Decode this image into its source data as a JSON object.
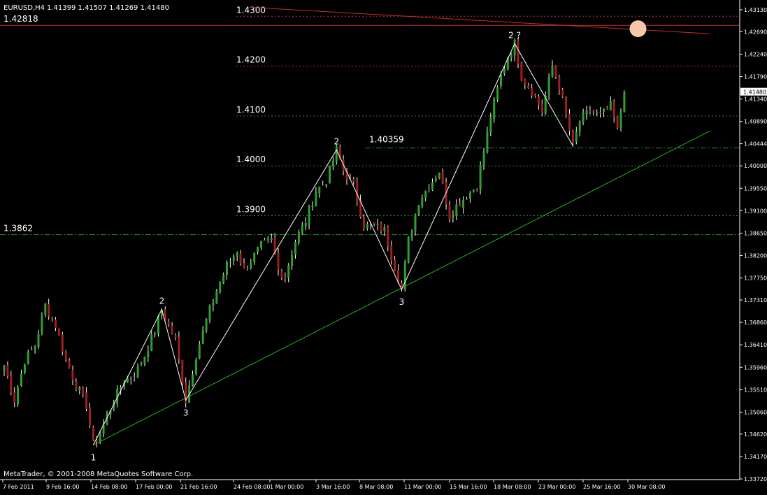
{
  "header": {
    "symbol": "EURUSD,H4",
    "ohlc": "1.41399 1.41507 1.41269 1.41480"
  },
  "footer": {
    "copyright": "MetaTrader, © 2001-2008 MetaQuotes Software Corp."
  },
  "colors": {
    "background": "#000000",
    "axis": "#ffffff",
    "bull": "#2ea02e",
    "bear": "#a0201e",
    "wick": "#ffffff",
    "level_red": "#c0302e",
    "level_green": "#2a8a2a",
    "trendline_red": "#c0302e",
    "trendline_green": "#22b322",
    "wave": "#ffffff",
    "marker": "#f4c8a8"
  },
  "chart_data": {
    "type": "candlestick",
    "symbol": "EURUSD",
    "timeframe": "H4",
    "y_ticks": [
      "1.43130",
      "1.42690",
      "1.42240",
      "1.41790",
      "1.41340",
      "1.40890",
      "1.40444",
      "1.40000",
      "1.39550",
      "1.39100",
      "1.38650",
      "1.38200",
      "1.37750",
      "1.37310",
      "1.36860",
      "1.36410",
      "1.35960",
      "1.35510",
      "1.35060",
      "1.34620",
      "1.34170",
      "1.33720"
    ],
    "x_ticks": [
      "7 Feb 2011",
      "9 Feb 16:00",
      "14 Feb 08:00",
      "17 Feb 00:00",
      "21 Feb 16:00",
      "24 Feb 08:00",
      "1 Mar 00:00",
      "3 Mar 16:00",
      "8 Mar 08:00",
      "11 Mar 00:00",
      "15 Mar 16:00",
      "18 Mar 08:00",
      "23 Mar 00:00",
      "25 Mar 16:00",
      "30 Mar 08:00"
    ],
    "ylim": [
      1.3372,
      1.4313
    ],
    "current_price": "1.41480",
    "levels": [
      {
        "label": "1.4300",
        "price": 1.43,
        "color": "red",
        "style": "dotted"
      },
      {
        "label": "1.42818",
        "price": 1.42818,
        "color": "red",
        "style": "solid"
      },
      {
        "label": "1.4200",
        "price": 1.42,
        "color": "red",
        "style": "dotted"
      },
      {
        "label": "1.4100",
        "price": 1.41,
        "color": "green",
        "style": "dotted"
      },
      {
        "label": "1.40359",
        "price": 1.40359,
        "color": "green",
        "style": "dashdot"
      },
      {
        "label": "1.4000",
        "price": 1.4,
        "color": "green",
        "style": "dotted"
      },
      {
        "label": "1.3900",
        "price": 1.39,
        "color": "green",
        "style": "dotted"
      },
      {
        "label": "1.3862",
        "price": 1.3862,
        "color": "green",
        "style": "dashdot"
      }
    ],
    "wave_labels": [
      "1",
      "2",
      "3",
      "2",
      "3",
      "2 ?"
    ],
    "wave_points": [
      {
        "label": "1",
        "bar": 26,
        "price": 1.344
      },
      {
        "label": "2",
        "bar": 46,
        "price": 1.3712
      },
      {
        "label": "3",
        "bar": 53,
        "price": 1.353
      },
      {
        "label": "2",
        "bar": 97,
        "price": 1.4032
      },
      {
        "label": "3",
        "bar": 116,
        "price": 1.3752
      },
      {
        "label": "2 ?",
        "bar": 149,
        "price": 1.4245
      },
      {
        "label": "",
        "bar": 166,
        "price": 1.404
      }
    ],
    "trendlines": [
      {
        "color": "green",
        "from": {
          "bar": 26,
          "price": 1.344
        },
        "to": {
          "bar": 206,
          "price": 1.407
        }
      },
      {
        "color": "red",
        "from": {
          "bar": 72,
          "price": 1.4318
        },
        "to": {
          "bar": 206,
          "price": 1.4265
        }
      }
    ],
    "marker": {
      "bar": 185,
      "price": 1.4275
    },
    "bar_count": 182,
    "anchors": [
      [
        0,
        1.36
      ],
      [
        3,
        1.353
      ],
      [
        6,
        1.361
      ],
      [
        9,
        1.364
      ],
      [
        12,
        1.372
      ],
      [
        15,
        1.368
      ],
      [
        18,
        1.361
      ],
      [
        21,
        1.356
      ],
      [
        24,
        1.352
      ],
      [
        26,
        1.344
      ],
      [
        29,
        1.348
      ],
      [
        32,
        1.353
      ],
      [
        35,
        1.357
      ],
      [
        38,
        1.358
      ],
      [
        41,
        1.362
      ],
      [
        44,
        1.367
      ],
      [
        46,
        1.3712
      ],
      [
        48,
        1.368
      ],
      [
        50,
        1.365
      ],
      [
        53,
        1.353
      ],
      [
        56,
        1.362
      ],
      [
        59,
        1.369
      ],
      [
        62,
        1.375
      ],
      [
        65,
        1.38
      ],
      [
        68,
        1.383
      ],
      [
        70,
        1.379
      ],
      [
        72,
        1.381
      ],
      [
        75,
        1.384
      ],
      [
        78,
        1.385
      ],
      [
        80,
        1.379
      ],
      [
        82,
        1.378
      ],
      [
        85,
        1.385
      ],
      [
        88,
        1.389
      ],
      [
        91,
        1.395
      ],
      [
        94,
        1.397
      ],
      [
        97,
        1.4032
      ],
      [
        99,
        1.399
      ],
      [
        102,
        1.396
      ],
      [
        105,
        1.388
      ],
      [
        108,
        1.388
      ],
      [
        111,
        1.387
      ],
      [
        113,
        1.382
      ],
      [
        116,
        1.3752
      ],
      [
        118,
        1.385
      ],
      [
        121,
        1.393
      ],
      [
        124,
        1.396
      ],
      [
        127,
        1.399
      ],
      [
        130,
        1.39
      ],
      [
        132,
        1.392
      ],
      [
        135,
        1.394
      ],
      [
        138,
        1.396
      ],
      [
        140,
        1.403
      ],
      [
        142,
        1.41
      ],
      [
        145,
        1.418
      ],
      [
        147,
        1.422
      ],
      [
        149,
        1.4245
      ],
      [
        151,
        1.418
      ],
      [
        154,
        1.415
      ],
      [
        157,
        1.411
      ],
      [
        160,
        1.42
      ],
      [
        162,
        1.416
      ],
      [
        164,
        1.41
      ],
      [
        166,
        1.404
      ],
      [
        168,
        1.409
      ],
      [
        171,
        1.411
      ],
      [
        174,
        1.41
      ],
      [
        177,
        1.412
      ],
      [
        179,
        1.407
      ],
      [
        181,
        1.4148
      ]
    ]
  }
}
